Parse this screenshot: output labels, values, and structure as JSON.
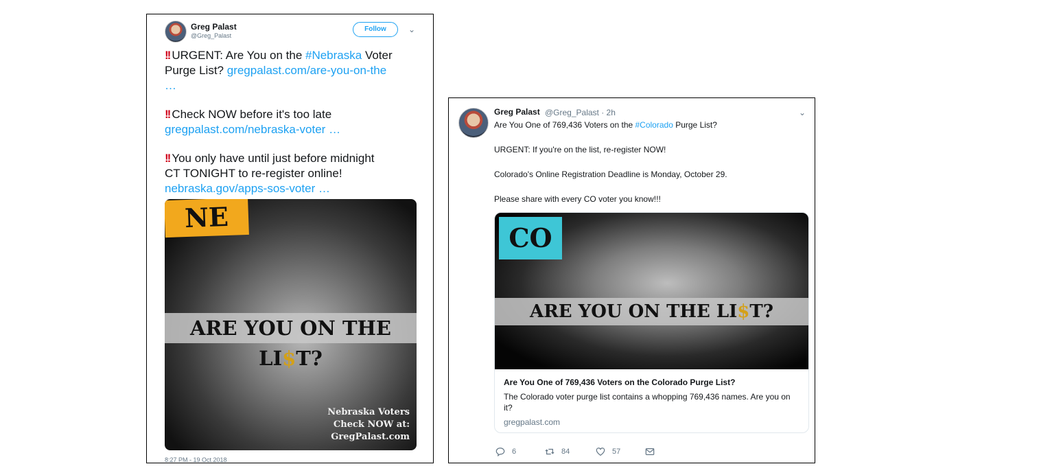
{
  "tweet1": {
    "user_name": "Greg Palast",
    "handle": "@Greg_Palast",
    "follow_label": "Follow",
    "line1_text": "URGENT: Are You on the ",
    "line1_hashtag": "#Nebraska",
    "line1_text2": " Voter",
    "line2_text": "Purge List? ",
    "line2_link": "gregpalast.com/are-you-on-the",
    "line3_link": "…",
    "line4_text": "Check NOW before it's too late",
    "line5_link": "gregpalast.com/nebraska-voter …",
    "line6_text": "You only have until just before midnight",
    "line7_text": "CT TONIGHT to re-register online!",
    "line8_link": "nebraska.gov/apps-sos-voter …",
    "image": {
      "state_tag": "NE",
      "banner_pre": "ARE YOU ON THE LI",
      "banner_dollar": "$",
      "banner_post": "T?",
      "caption_line1": "Nebraska Voters",
      "caption_line2": "Check NOW at:",
      "caption_line3": "GregPalast.com"
    },
    "timestamp": "8:27 PM - 19 Oct 2018"
  },
  "tweet2": {
    "user_name": "Greg Palast",
    "handle_time": "@Greg_Palast · 2h",
    "line1_text": "Are You One of 769,436 Voters on the ",
    "line1_hashtag": "#Colorado",
    "line1_text2": " Purge List?",
    "line2_text": "URGENT: If you're on the list, re-register NOW!",
    "line3_text": "Colorado's Online Registration Deadline is Monday, October 29.",
    "line4_text": "Please share with every CO voter you know!!!",
    "card": {
      "state_tag": "CO",
      "banner_pre": "ARE YOU ON THE LI",
      "banner_dollar": "$",
      "banner_post": "T?",
      "title": "Are You One of 769,436 Voters on the Colorado Purge List?",
      "description": "The Colorado voter purge list contains a whopping 769,436 names. Are you on it?",
      "url": "gregpalast.com"
    },
    "actions": {
      "replies": "6",
      "retweets": "84",
      "likes": "57"
    }
  },
  "colors": {
    "link_blue": "#1da1f2",
    "bang_red": "#d0021b",
    "ne_tag_bg": "#f2a81d",
    "co_tag_bg": "#3ec6d6"
  },
  "icons": [
    "exclamation-icon",
    "chevron-down-icon",
    "reply-icon",
    "retweet-icon",
    "like-icon",
    "message-icon"
  ]
}
